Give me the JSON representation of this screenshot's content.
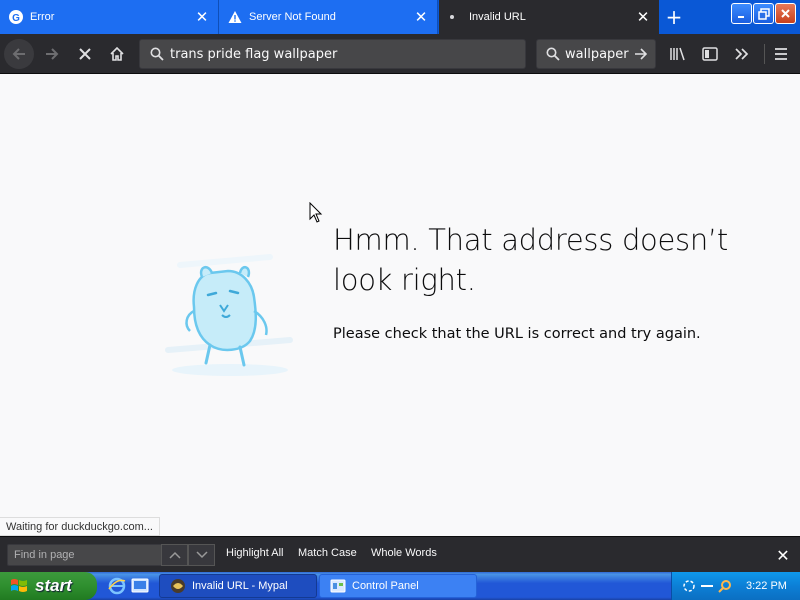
{
  "browser": {
    "tabs": [
      {
        "title": "Error",
        "icon": "google-g-icon",
        "active": false
      },
      {
        "title": "Server Not Found",
        "icon": "warning-icon",
        "active": false
      },
      {
        "title": "Invalid URL",
        "icon": "dot-icon",
        "active": true
      }
    ],
    "close_glyph": "✕",
    "new_tab_glyph": "+",
    "address": "trans pride flag wallpaper",
    "search_value": "wallpaper"
  },
  "page": {
    "title": "Hmm. That address doesn’t look right.",
    "description": "Please check that the URL is correct and try again."
  },
  "status": {
    "text": "Waiting for duckduckgo.com..."
  },
  "findbar": {
    "placeholder": "Find in page",
    "highlight_all": "Highlight All",
    "match_case": "Match Case",
    "whole_words": "Whole Words"
  },
  "taskbar": {
    "start_label": "start",
    "tasks": [
      {
        "label": "Invalid URL - Mypal",
        "active": true
      },
      {
        "label": "Control Panel",
        "active": false
      }
    ],
    "clock": "3:22 PM"
  }
}
